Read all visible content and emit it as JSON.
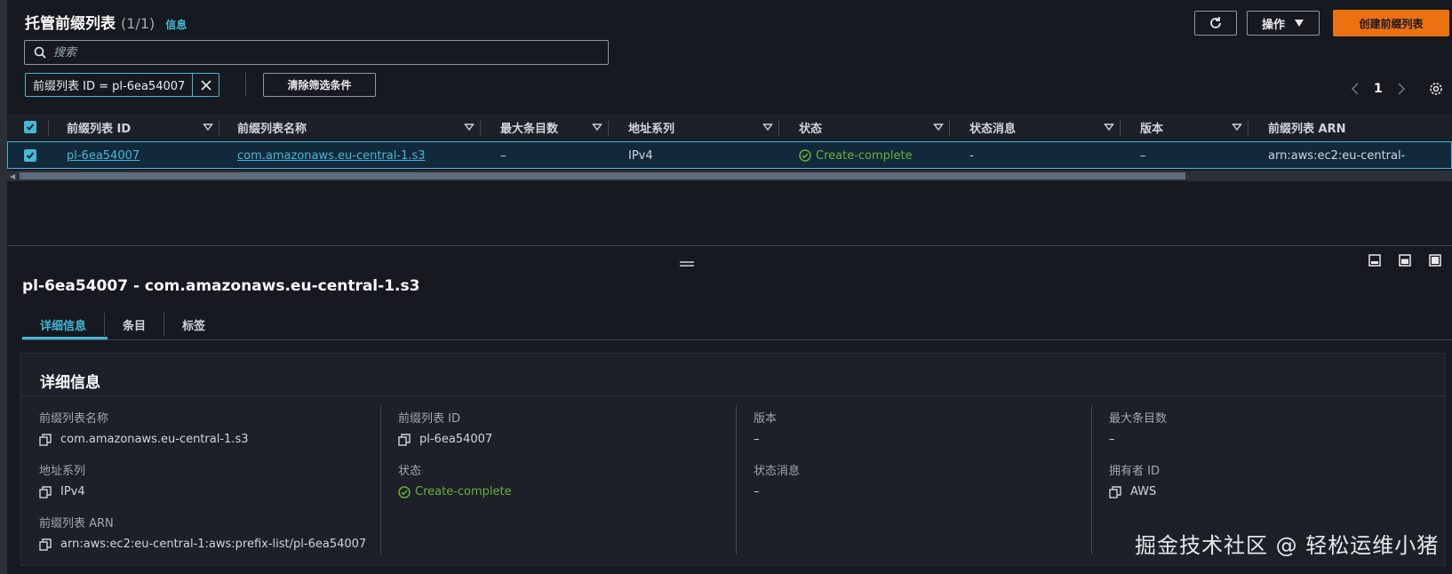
{
  "header": {
    "title": "托管前缀列表",
    "count": "(1/1)",
    "info_link": "信息",
    "actions_label": "操作",
    "create_label": "创建前缀列表"
  },
  "search": {
    "placeholder": "搜索"
  },
  "filter": {
    "token_label": "前缀列表 ID = pl-6ea54007",
    "clear_label": "清除筛选条件"
  },
  "pagination": {
    "current_page": "1"
  },
  "table": {
    "columns": [
      "前缀列表 ID",
      "前缀列表名称",
      "最大条目数",
      "地址系列",
      "状态",
      "状态消息",
      "版本",
      "前缀列表 ARN"
    ],
    "rows": [
      {
        "id": "pl-6ea54007",
        "name": "com.amazonaws.eu-central-1.s3",
        "max_entries": "–",
        "address_family": "IPv4",
        "status": "Create-complete",
        "status_message": "-",
        "version": "–",
        "arn": "arn:aws:ec2:eu-central-"
      }
    ]
  },
  "details": {
    "title": "pl-6ea54007 - com.amazonaws.eu-central-1.s3",
    "tabs": [
      "详细信息",
      "条目",
      "标签"
    ],
    "card_title": "详细信息",
    "fields": {
      "name_label": "前缀列表名称",
      "name_value": "com.amazonaws.eu-central-1.s3",
      "family_label": "地址系列",
      "family_value": "IPv4",
      "arn_label": "前缀列表 ARN",
      "arn_value": "arn:aws:ec2:eu-central-1:aws:prefix-list/pl-6ea54007",
      "id_label": "前缀列表 ID",
      "id_value": "pl-6ea54007",
      "status_label": "状态",
      "status_value": "Create-complete",
      "version_label": "版本",
      "version_value": "–",
      "status_msg_label": "状态消息",
      "status_msg_value": "–",
      "max_label": "最大条目数",
      "max_value": "–",
      "owner_label": "拥有者 ID",
      "owner_value": "AWS"
    }
  },
  "watermark": "掘金技术社区 @ 轻松运维小猪",
  "colors": {
    "accent": "#44b9d6",
    "primary_button": "#ec7211",
    "success": "#6aaf35",
    "background": "#16191f"
  }
}
